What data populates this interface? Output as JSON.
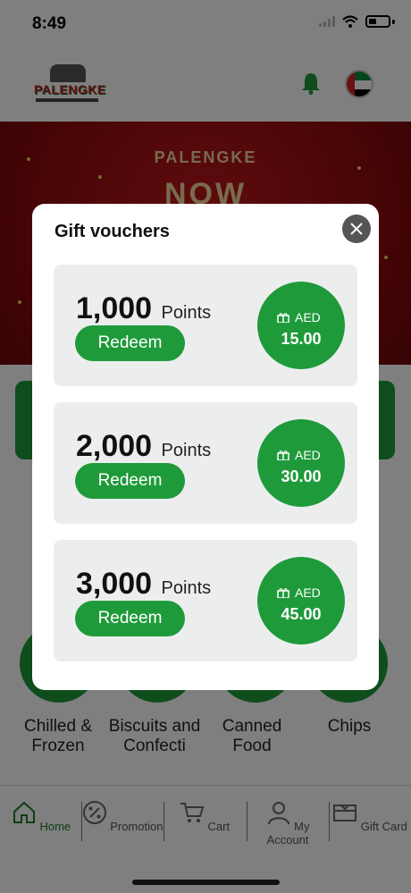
{
  "status_bar": {
    "time": "8:49"
  },
  "modal": {
    "title": "Gift vouchers",
    "vouchers": [
      {
        "points": "1,000",
        "points_label": "Points",
        "redeem_label": "Redeem",
        "currency": "AED",
        "amount": "15.00"
      },
      {
        "points": "2,000",
        "points_label": "Points",
        "redeem_label": "Redeem",
        "currency": "AED",
        "amount": "30.00"
      },
      {
        "points": "3,000",
        "points_label": "Points",
        "redeem_label": "Redeem",
        "currency": "AED",
        "amount": "45.00"
      }
    ]
  },
  "categories": [
    {
      "label": "Chilled & Frozen"
    },
    {
      "label": "Biscuits and Confecti"
    },
    {
      "label": "Canned Food"
    },
    {
      "label": "Chips"
    }
  ],
  "tabs": [
    {
      "label": "Home",
      "active": true,
      "icon": "home-icon"
    },
    {
      "label": "Promotion",
      "icon": "percent-icon"
    },
    {
      "label": "Cart",
      "icon": "cart-icon"
    },
    {
      "label": "My Account",
      "icon": "user-icon"
    },
    {
      "label": "Gift Card",
      "icon": "gift-card-icon"
    }
  ],
  "colors": {
    "accent": "#1f9a3b",
    "overlay": "rgba(0,0,0,0.5)"
  }
}
